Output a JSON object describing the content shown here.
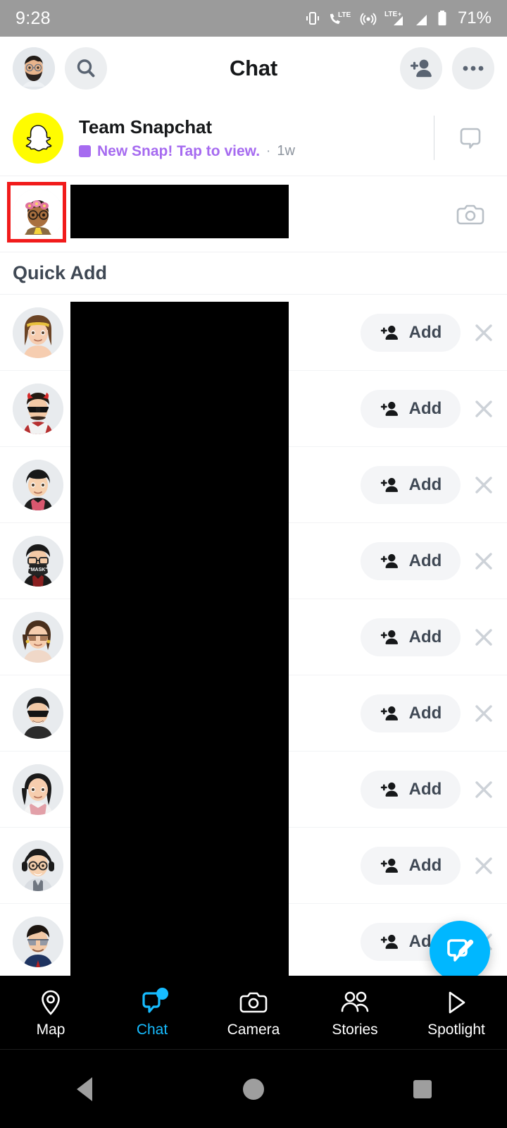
{
  "status_bar": {
    "time": "9:28",
    "battery_percent": "71%",
    "icons": [
      "vibrate-icon",
      "lte-call-icon",
      "hotspot-icon",
      "lte-plus-signal-icon",
      "signal-icon",
      "battery-icon"
    ]
  },
  "header": {
    "title": "Chat",
    "profile_avatar": "profile-bitmoji-avatar",
    "search_icon": "search-icon",
    "add_friend_icon": "add-friend-icon",
    "more_icon": "more-options-icon"
  },
  "chats": [
    {
      "name": "Team Snapchat",
      "status": "New Snap! Tap to view.",
      "separator": "·",
      "time": "1w",
      "avatar": "snapchat-ghost-logo",
      "action_icon": "chat-bubble-icon",
      "status_color": "#a66bf0"
    },
    {
      "name": "",
      "status": "",
      "time": "",
      "avatar": "friend-bitmoji-avatar",
      "action_icon": "camera-icon",
      "redacted": true,
      "highlighted": true
    }
  ],
  "quick_add": {
    "title": "Quick Add",
    "add_label": "Add",
    "add_icon": "add-friend-icon",
    "dismiss_icon": "close-icon",
    "rows": [
      {
        "name": "",
        "avatar": "bitmoji-woman-headband"
      },
      {
        "name": "",
        "avatar": "bitmoji-man-sunglasses-devil-horns"
      },
      {
        "name": "",
        "avatar": "bitmoji-woman-short-hair"
      },
      {
        "name": "",
        "avatar": "bitmoji-man-mask-glasses"
      },
      {
        "name": "",
        "avatar": "bitmoji-woman-sunglasses"
      },
      {
        "name": "",
        "avatar": "bitmoji-man-dark-sunglasses"
      },
      {
        "name": "",
        "avatar": "bitmoji-woman-long-hair"
      },
      {
        "name": "",
        "avatar": "bitmoji-man-headphones-glasses"
      },
      {
        "name": "",
        "avatar": "bitmoji-man-aviator-sunglasses"
      },
      {
        "name": "",
        "avatar": "bitmoji-partial-row"
      }
    ]
  },
  "fab": {
    "icon": "new-chat-compose-icon",
    "color": "#00b7ff"
  },
  "bottom_nav": {
    "active": "Chat",
    "items": [
      {
        "label": "Map",
        "icon": "map-pin-icon",
        "active": false,
        "badge": false
      },
      {
        "label": "Chat",
        "icon": "chat-icon",
        "active": true,
        "badge": true
      },
      {
        "label": "Camera",
        "icon": "camera-icon",
        "active": false,
        "badge": false
      },
      {
        "label": "Stories",
        "icon": "people-icon",
        "active": false,
        "badge": false
      },
      {
        "label": "Spotlight",
        "icon": "play-arrow-icon",
        "active": false,
        "badge": false
      }
    ]
  },
  "android_nav": {
    "back": "back-triangle-icon",
    "home": "home-circle-icon",
    "recents": "recents-square-icon"
  },
  "colors": {
    "accent_blue": "#00b7ff",
    "snap_yellow": "#FFFC00",
    "purple_status": "#a66bf0",
    "highlight_red": "#f11b1b",
    "status_bar_bg": "#9b9b9b"
  }
}
